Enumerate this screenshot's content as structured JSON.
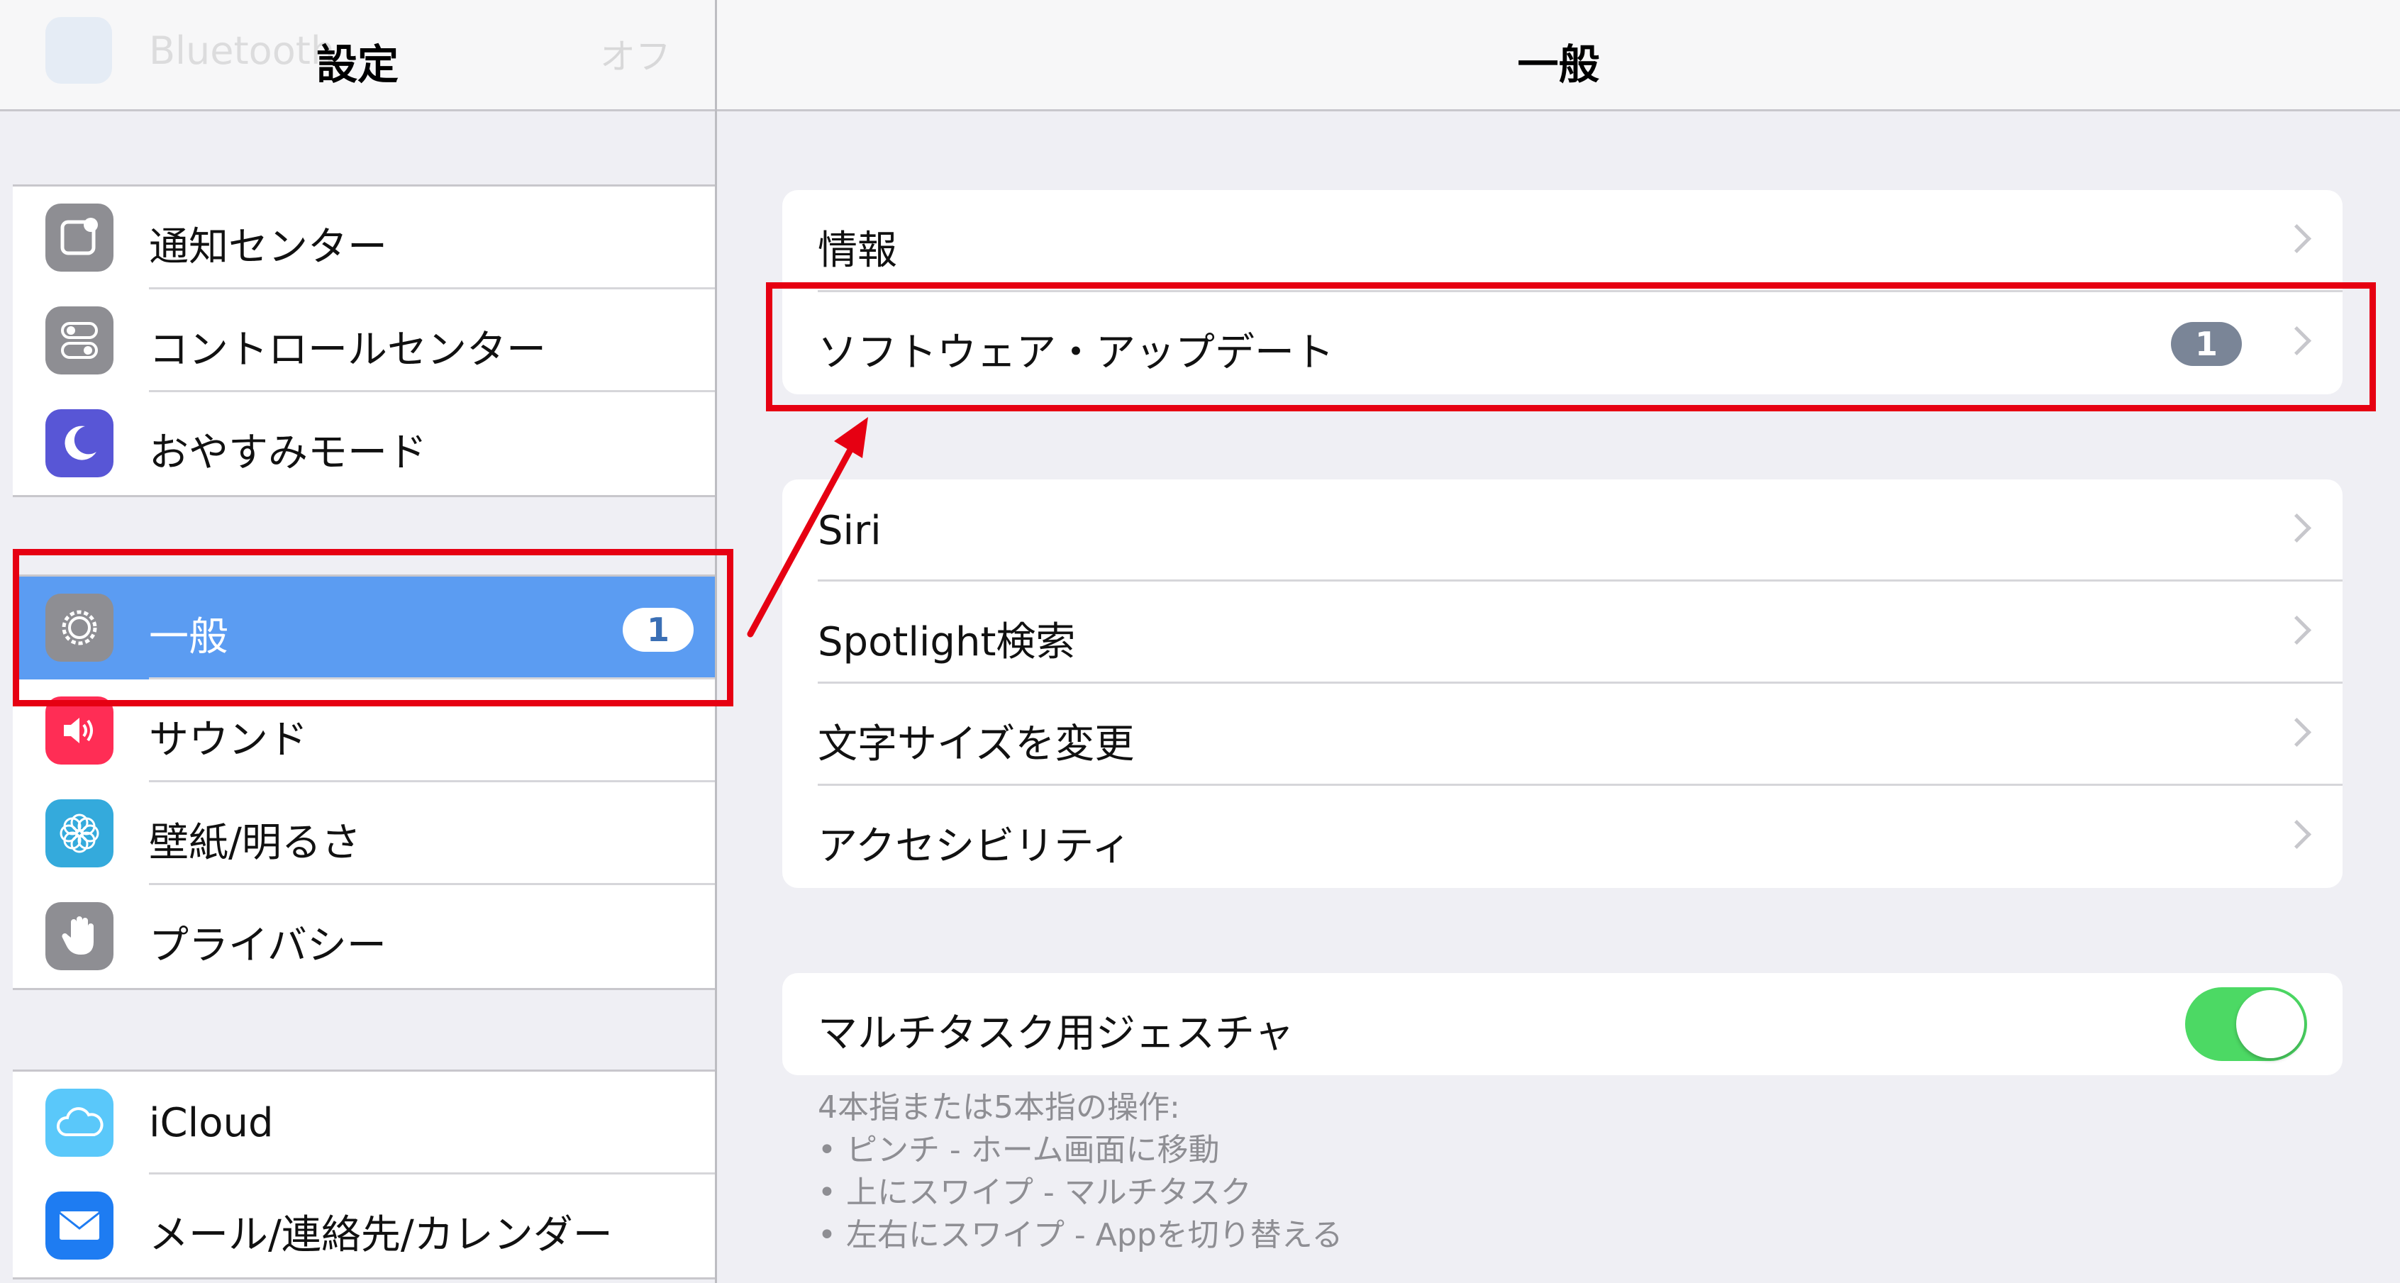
{
  "sidebar": {
    "ghost_row": {
      "label": "Bluetooth",
      "value": "オフ"
    },
    "title": "設定",
    "groups": [
      {
        "items": [
          {
            "label": "通知センター",
            "icon": "notification-center-icon",
            "color": "#8e8e93"
          },
          {
            "label": "コントロールセンター",
            "icon": "control-center-icon",
            "color": "#8e8e93"
          },
          {
            "label": "おやすみモード",
            "icon": "moon-icon",
            "color": "#5856d6"
          }
        ]
      },
      {
        "items": [
          {
            "label": "一般",
            "icon": "gear-icon",
            "color": "#8e8e93",
            "badge": "1",
            "selected": true
          },
          {
            "label": "サウンド",
            "icon": "speaker-icon",
            "color": "#ff2d55"
          },
          {
            "label": "壁紙/明るさ",
            "icon": "flower-icon",
            "color": "#34aadc"
          },
          {
            "label": "プライバシー",
            "icon": "hand-icon",
            "color": "#8e8e93"
          }
        ]
      },
      {
        "items": [
          {
            "label": "iCloud",
            "icon": "cloud-icon",
            "color": "#5ac8fa"
          },
          {
            "label": "メール/連絡先/カレンダー",
            "icon": "mail-icon",
            "color": "#1e7cf2"
          }
        ]
      }
    ]
  },
  "main": {
    "title": "一般",
    "groups": [
      {
        "rows": [
          {
            "label": "情報"
          },
          {
            "label": "ソフトウェア・アップデート",
            "badge": "1"
          }
        ]
      },
      {
        "rows": [
          {
            "label": "Siri"
          },
          {
            "label": "Spotlight検索"
          },
          {
            "label": "文字サイズを変更"
          },
          {
            "label": "アクセシビリティ"
          }
        ]
      },
      {
        "rows": [
          {
            "label": "マルチタスク用ジェスチャ",
            "toggle": true
          }
        ]
      }
    ],
    "footnote": [
      "4本指または5本指の操作:",
      "• ピンチ - ホーム画面に移動",
      "• 上にスワイプ - マルチタスク",
      "• 左右にスワイプ - Appを切り替える"
    ]
  },
  "colors": {
    "selected_row": "#5b9cf2",
    "highlight": "#e60012",
    "toggle_on": "#4cd964"
  }
}
